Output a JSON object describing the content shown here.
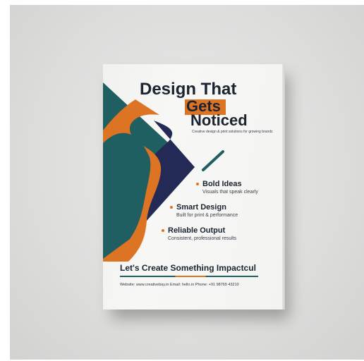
{
  "flyer": {
    "headline_line1": "Design That",
    "headline_line2": "Gets",
    "headline_line3": "Noticed",
    "tagline": "Creative design & print solutions for growing brands",
    "features": [
      {
        "title": "Bold Ideas",
        "subtitle": "Visuals that speak clearly"
      },
      {
        "title": "Smart Design",
        "subtitle": "Built for print & performance"
      },
      {
        "title": "Reliable Output",
        "subtitle": "Consistent, professional results"
      }
    ],
    "cta": "Let's Create Something Impactcul",
    "contact": "Website: www.creativebay.in  Email: hello.in  Phone: +91 98765 43210"
  },
  "colors": {
    "teal": "#1f5f62",
    "orange": "#dd7423",
    "navy": "#232a55",
    "text_dark": "#1b2430",
    "background": "#dedede"
  }
}
